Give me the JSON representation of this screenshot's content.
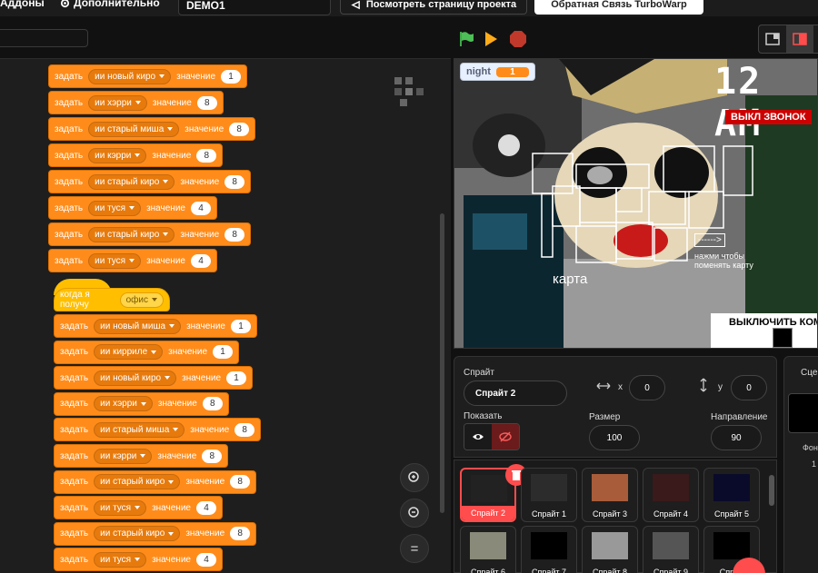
{
  "menu": {
    "addons": "Аддоны",
    "advanced": "Дополнительно",
    "project_title": "DEMO1",
    "see_project": "Посмотреть страницу проекта",
    "feedback": "Обратная Связь TurboWarp"
  },
  "code": {
    "blocks_a": [
      {
        "verb": "задать",
        "var": "ии новый киро",
        "word": "значение",
        "value": "1"
      },
      {
        "verb": "задать",
        "var": "ии хэрри",
        "word": "значение",
        "value": "8"
      },
      {
        "verb": "задать",
        "var": "ии старый миша",
        "word": "значение",
        "value": "8"
      },
      {
        "verb": "задать",
        "var": "ии кэрри",
        "word": "значение",
        "value": "8"
      },
      {
        "verb": "задать",
        "var": "ии старый киро",
        "word": "значение",
        "value": "8"
      },
      {
        "verb": "задать",
        "var": "ии туся",
        "word": "значение",
        "value": "4"
      },
      {
        "verb": "задать",
        "var": "ии старый киро",
        "word": "значение",
        "value": "8"
      },
      {
        "verb": "задать",
        "var": "ии туся",
        "word": "значение",
        "value": "4"
      }
    ],
    "hat": {
      "label": "когда я получу",
      "message": "офис"
    },
    "blocks_b": [
      {
        "verb": "задать",
        "var": "ии новый миша",
        "word": "значение",
        "value": "1"
      },
      {
        "verb": "задать",
        "var": "ии кирриле",
        "word": "значение",
        "value": "1"
      },
      {
        "verb": "задать",
        "var": "ии новый киро",
        "word": "значение",
        "value": "1"
      },
      {
        "verb": "задать",
        "var": "ии хэрри",
        "word": "значение",
        "value": "8"
      },
      {
        "verb": "задать",
        "var": "ии старый миша",
        "word": "значение",
        "value": "8"
      },
      {
        "verb": "задать",
        "var": "ии кэрри",
        "word": "значение",
        "value": "8"
      },
      {
        "verb": "задать",
        "var": "ии старый киро",
        "word": "значение",
        "value": "8"
      },
      {
        "verb": "задать",
        "var": "ии туся",
        "word": "значение",
        "value": "4"
      },
      {
        "verb": "задать",
        "var": "ии старый киро",
        "word": "значение",
        "value": "8"
      },
      {
        "verb": "задать",
        "var": "ии туся",
        "word": "значение",
        "value": "4"
      }
    ],
    "zoom_in": "+",
    "zoom_out": "−",
    "zoom_reset": "="
  },
  "stage": {
    "monitor_label": "night",
    "monitor_value": "1",
    "time": "12 AM",
    "call_off": "ВЫКЛ ЗВОНОК",
    "map_label": "карта",
    "arrow": "------>",
    "tap_hint": "нажми чтобы поменять карту",
    "disable": "ВЫКЛЮЧИТЬ КОМ"
  },
  "sprite_info": {
    "title": "Спрайт",
    "name": "Спрайт 2",
    "x_label": "x",
    "x": "0",
    "y_label": "y",
    "y": "0",
    "show_label": "Показать",
    "size_label": "Размер",
    "size": "100",
    "direction_label": "Направление",
    "direction": "90"
  },
  "sprites": [
    {
      "name": "Спрайт 2",
      "selected": true
    },
    {
      "name": "Спрайт 1"
    },
    {
      "name": "Спрайт 3"
    },
    {
      "name": "Спрайт 4"
    },
    {
      "name": "Спрайт 5"
    },
    {
      "name": "Спрайт 6"
    },
    {
      "name": "Спрайт 7"
    },
    {
      "name": "Спрайт 8"
    },
    {
      "name": "Спрайт 9"
    },
    {
      "name": "Спрай"
    }
  ],
  "stage_panel": {
    "title": "Сцен",
    "backdrops_label": "Фон",
    "backdrops_count": "1"
  },
  "colors": {
    "motion_orange": "#ff8c1a",
    "event_yellow": "#ffbf00",
    "delete_red": "#ff4c4c",
    "flag_green": "#4cbf56"
  }
}
